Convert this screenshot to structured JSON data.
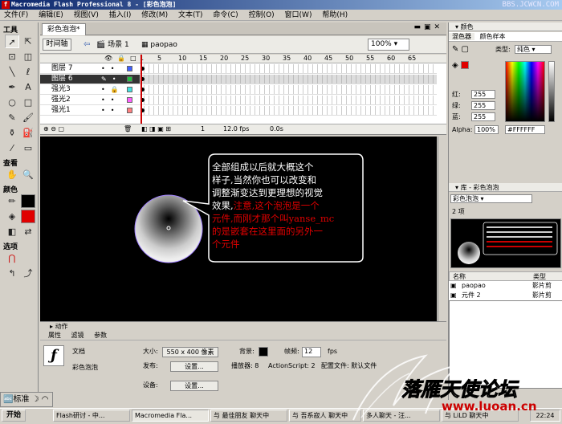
{
  "window": {
    "title": "Macromedia Flash Professional 8 - [彩色泡泡]",
    "watermark": "BBS.JCWCN.COM"
  },
  "menu": [
    "文件(F)",
    "编辑(E)",
    "视图(V)",
    "插入(I)",
    "修改(M)",
    "文本(T)",
    "命令(C)",
    "控制(O)",
    "窗口(W)",
    "帮助(H)"
  ],
  "tools": {
    "title": "工具",
    "view_label": "查看",
    "color_label": "颜色",
    "options_label": "选项"
  },
  "document": {
    "tab": "彩色泡泡*",
    "timeline_button": "时间轴",
    "scene": "场景 1",
    "symbol": "paopao",
    "zoom": "100%"
  },
  "timeline": {
    "ruler": [
      "1",
      "5",
      "10",
      "15",
      "20",
      "25",
      "30",
      "35",
      "40",
      "45",
      "50",
      "55",
      "60",
      "65"
    ],
    "layers": [
      {
        "name": "图层 7",
        "color": "#4060ff",
        "selected": false
      },
      {
        "name": "图层 6",
        "color": "#20c040",
        "selected": true
      },
      {
        "name": "强光3",
        "color": "#40e0e0",
        "selected": false
      },
      {
        "name": "强光2",
        "color": "#ff60ff",
        "selected": false
      },
      {
        "name": "强光1",
        "color": "#ff8080",
        "selected": false
      }
    ],
    "frame": "1",
    "fps": "12.0 fps",
    "time": "0.0s"
  },
  "stage": {
    "callout_lines_white": [
      "全部组成以后就大概这个",
      "样子,当然你也可以改变和",
      "调整渐变达到更理想的视觉",
      "效果,"
    ],
    "callout_red_inline": "注意,这个泡泡是一个",
    "callout_lines_red": [
      "元件,而刚才那个叫yanse_mc",
      "的是嵌套在这里面的另外一",
      "个元件"
    ]
  },
  "actions_label": "动作",
  "properties": {
    "tabs": [
      "属性",
      "滤镜",
      "参数"
    ],
    "type_label": "文档",
    "doc_name": "彩色泡泡",
    "size_label": "大小:",
    "size_value": "550 x 400 像素",
    "bg_label": "背景:",
    "fps_label": "帧频:",
    "fps_value": "12",
    "fps_unit": "fps",
    "publish_label": "发布:",
    "settings_button": "设置...",
    "player_label": "播放器: 8",
    "as_label": "ActionScript: 2",
    "profile_label": "配置文件: 默认文件",
    "device_label": "设备:",
    "device_button": "设置..."
  },
  "color_panel": {
    "title": "颜色",
    "tab_mixer": "混色器",
    "tab_swatches": "颜色样本",
    "type_label": "类型:",
    "type_value": "纯色",
    "red_label": "红:",
    "green_label": "绿:",
    "blue_label": "蓝:",
    "red": "255",
    "green": "255",
    "blue": "255",
    "alpha_label": "Alpha:",
    "alpha": "100%",
    "hex": "#FFFFFF"
  },
  "library": {
    "title": "库 - 彩色泡泡",
    "doc": "彩色泡泡",
    "count": "2 项",
    "col_name": "名称",
    "col_type": "类型",
    "items": [
      {
        "name": "paopao",
        "type": "影片剪"
      },
      {
        "name": "元件 2",
        "type": "影片剪"
      }
    ]
  },
  "taskbar": {
    "start": "开始",
    "std": "标准",
    "tasks": [
      "Flash研讨 - 中...",
      "Macromedia Fla...",
      "与 最佳朋友 聊天中",
      "与 吾系寂人 聊天中",
      "多人聊天 - 汪...",
      "与 LiLD 聊天中"
    ],
    "clock": "22:24"
  },
  "brand": {
    "name": "落雁天使论坛",
    "site": "www.luoan.cn"
  },
  "colors": {
    "stage_bg": "#000000",
    "selected_layer": "#333333",
    "red_text": "#e00000"
  }
}
